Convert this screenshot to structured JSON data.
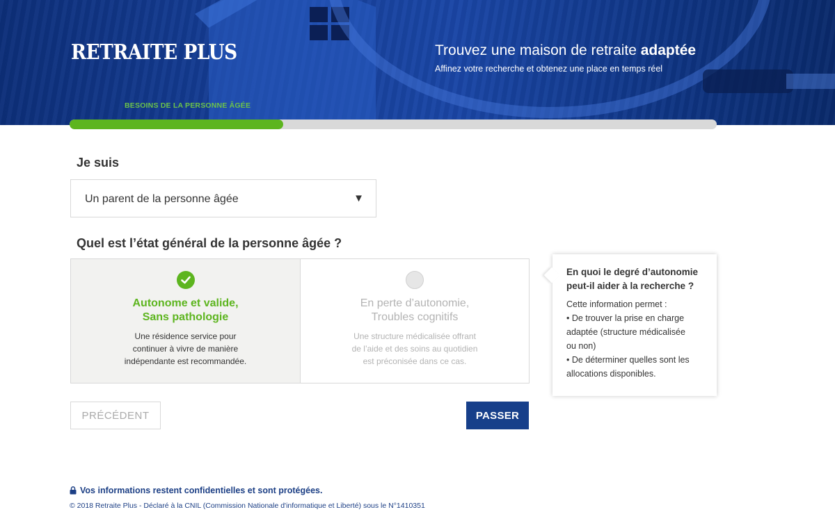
{
  "header": {
    "logo": "RETRAITE PLUS",
    "tagline_prefix": "Trouvez une maison de retraite ",
    "tagline_bold": "adaptée",
    "subtagline": "Affinez votre recherche et obtenez une place en temps réel",
    "step_label": "BESOINS DE LA PERSONNE ÂGÉE"
  },
  "progress": {
    "percent": 33,
    "color": "#5db51f"
  },
  "form": {
    "question1": "Je suis",
    "select_value": "Un parent de la personne âgée",
    "question2": "Quel est l’état général de la personne âgée ?",
    "options": [
      {
        "title_line1": "Autonome et valide,",
        "title_line2": "Sans pathologie",
        "desc": [
          "Une résidence service pour",
          "continuer à vivre de manière",
          "indépendante est recommandée."
        ],
        "selected": true
      },
      {
        "title_line1": "En perte d’autonomie,",
        "title_line2": "Troubles cognitifs",
        "desc": [
          "Une structure médicalisée offrant",
          "de l’aide et des soins au quotidien",
          "est préconisée dans ce cas."
        ],
        "selected": false
      }
    ],
    "prev_label": "PRÉCÉDENT",
    "next_label": "PASSER"
  },
  "tooltip": {
    "title_line1": "En quoi le degré d’autonomie",
    "title_line2": "peut-il aider à la recherche ?",
    "body": [
      "Cette information permet :",
      "• De trouver la prise en charge",
      "adaptée (structure médicalisée",
      "ou non)",
      "• De déterminer quelles sont les",
      "allocations disponibles."
    ]
  },
  "footer": {
    "secure_text": "Vos informations restent confidentielles et sont protégées.",
    "copyright": "© 2018 Retraite Plus - Déclaré à la CNIL (Commission Nationale d'informatique et Liberté) sous le N°1410351"
  },
  "colors": {
    "brand_blue": "#173f8a",
    "accent_green": "#5db51f",
    "footer_blue": "#1c3f85"
  },
  "icons": [
    "check-icon",
    "dropdown-arrow-icon",
    "lock-icon"
  ]
}
